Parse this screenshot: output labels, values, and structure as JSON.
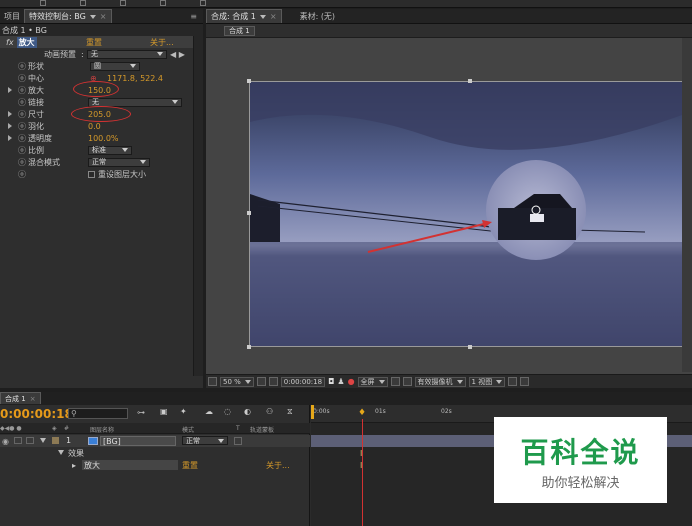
{
  "effect_panel": {
    "tabs": [
      {
        "label": "项目",
        "active": false
      },
      {
        "label": "特效控制台: BG",
        "active": true
      }
    ],
    "header": "合成 1 • BG",
    "effect": {
      "badge": "fx",
      "name": "放大",
      "reset": "重置",
      "about": "关于..."
    },
    "rows": [
      {
        "label": "动画预置",
        "value": "无",
        "arrows": "◀ ▶"
      },
      {
        "label": "形状",
        "value": "圆"
      },
      {
        "label": "中心",
        "value": "1171.8, 522.4"
      },
      {
        "label": "放大",
        "value": "150.0"
      },
      {
        "label": "链接",
        "value": "无"
      },
      {
        "label": "尺寸",
        "value": "205.0"
      },
      {
        "label": "羽化",
        "value": "0.0"
      },
      {
        "label": "透明度",
        "value": "100.0%"
      },
      {
        "label": "比例",
        "value": "标准"
      },
      {
        "label": "混合模式",
        "value": "正常"
      },
      {
        "label": "",
        "value": "重设图层大小"
      }
    ]
  },
  "comp_panel": {
    "tabs": [
      {
        "label": "合成: 合成 1",
        "active": true
      },
      {
        "label": "素材: (无)",
        "active": false
      }
    ],
    "subtab": "合成 1",
    "bottom": {
      "zoom": "50 %",
      "timecode": "0:00:00:18",
      "resolution": "全屏",
      "camera": "有效摄像机",
      "view": "1 视图"
    }
  },
  "timeline": {
    "tab": "合成 1",
    "timecode": "0:00:00:18",
    "columns": {
      "num": "#",
      "name": "图层名称",
      "mode": "模式",
      "t": "T",
      "trkmat": "轨道蒙板"
    },
    "ruler": [
      "0:00s",
      "01s",
      "02s"
    ],
    "layer": {
      "num": "1",
      "name": "[BG]",
      "mode": "正常"
    },
    "effects_label": "效果",
    "effect_row": {
      "name": "放大",
      "reset": "重置",
      "about": "关于..."
    }
  },
  "watermark": {
    "title": "百科全说",
    "subtitle": "助你轻松解决"
  },
  "colors": {
    "accent_orange": "#d69a2a",
    "annotation_red": "#d23232",
    "watermark_green": "#1f9a4c"
  }
}
